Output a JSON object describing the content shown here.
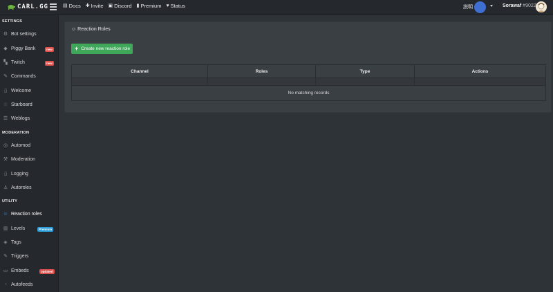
{
  "topbar": {
    "logo_text": "CARL.GG",
    "nav": [
      {
        "icon": "book-icon",
        "glyph": "▤",
        "label": "Docs"
      },
      {
        "icon": "plus-icon",
        "glyph": "✚",
        "label": "Invite"
      },
      {
        "icon": "discord-icon",
        "glyph": "▣",
        "label": "Discord"
      },
      {
        "icon": "patreon-icon",
        "glyph": "▮",
        "label": "Premium"
      },
      {
        "icon": "heart-icon",
        "glyph": "♥",
        "label": "Status"
      }
    ],
    "language": "説明",
    "user_name": "Sorawaf",
    "user_discriminator": "#9022"
  },
  "sidebar": {
    "sections": [
      {
        "title": "SETTINGS"
      },
      {
        "title": "MODERATION"
      },
      {
        "title": "UTILITY"
      }
    ],
    "items": [
      {
        "label": "Bot settings",
        "icon": "gear-icon",
        "glyph": "⚙"
      },
      {
        "label": "Piggy Bank",
        "icon": "piggy-bank-icon",
        "glyph": "◆",
        "badge": "new"
      },
      {
        "label": "Twitch",
        "icon": "twitch-icon",
        "glyph": "▚",
        "badge": "new"
      },
      {
        "label": "Commands",
        "icon": "pencil-icon",
        "glyph": "✎"
      },
      {
        "label": "Welcome",
        "icon": "door-icon",
        "glyph": "▯"
      },
      {
        "label": "Starboard",
        "icon": "star-icon",
        "glyph": "☆"
      },
      {
        "label": "Weblogs",
        "icon": "list-icon",
        "glyph": "☰"
      },
      {
        "label": "Automod",
        "icon": "shield-icon",
        "glyph": "◎"
      },
      {
        "label": "Moderation",
        "icon": "hammer-icon",
        "glyph": "⚒"
      },
      {
        "label": "Logging",
        "icon": "file-icon",
        "glyph": "▯"
      },
      {
        "label": "Autoroles",
        "icon": "users-icon",
        "glyph": "♙"
      },
      {
        "label": "Reaction roles",
        "icon": "smile-icon",
        "glyph": "☺"
      },
      {
        "label": "Levels",
        "icon": "bar-chart-icon",
        "glyph": "▥",
        "badge": "Premium"
      },
      {
        "label": "Tags",
        "icon": "tag-icon",
        "glyph": "◈"
      },
      {
        "label": "Triggers",
        "icon": "bolt-icon",
        "glyph": "✎"
      },
      {
        "label": "Embeds",
        "icon": "code-icon",
        "glyph": "▭",
        "badge": "updated"
      },
      {
        "label": "Autofeeds",
        "icon": "rss-icon",
        "glyph": "◔"
      }
    ]
  },
  "panel": {
    "title": "Reaction Roles",
    "create_button": "Create new reaction role",
    "table": {
      "columns": [
        "Channel",
        "Roles",
        "Type",
        "Actions"
      ],
      "empty_message": "No matching records"
    }
  },
  "colors": {
    "accent_green": "#3ea75a",
    "badge_red": "#e0504b",
    "badge_blue": "#2b9bd6",
    "server_avatar": "#3f6fd1"
  }
}
